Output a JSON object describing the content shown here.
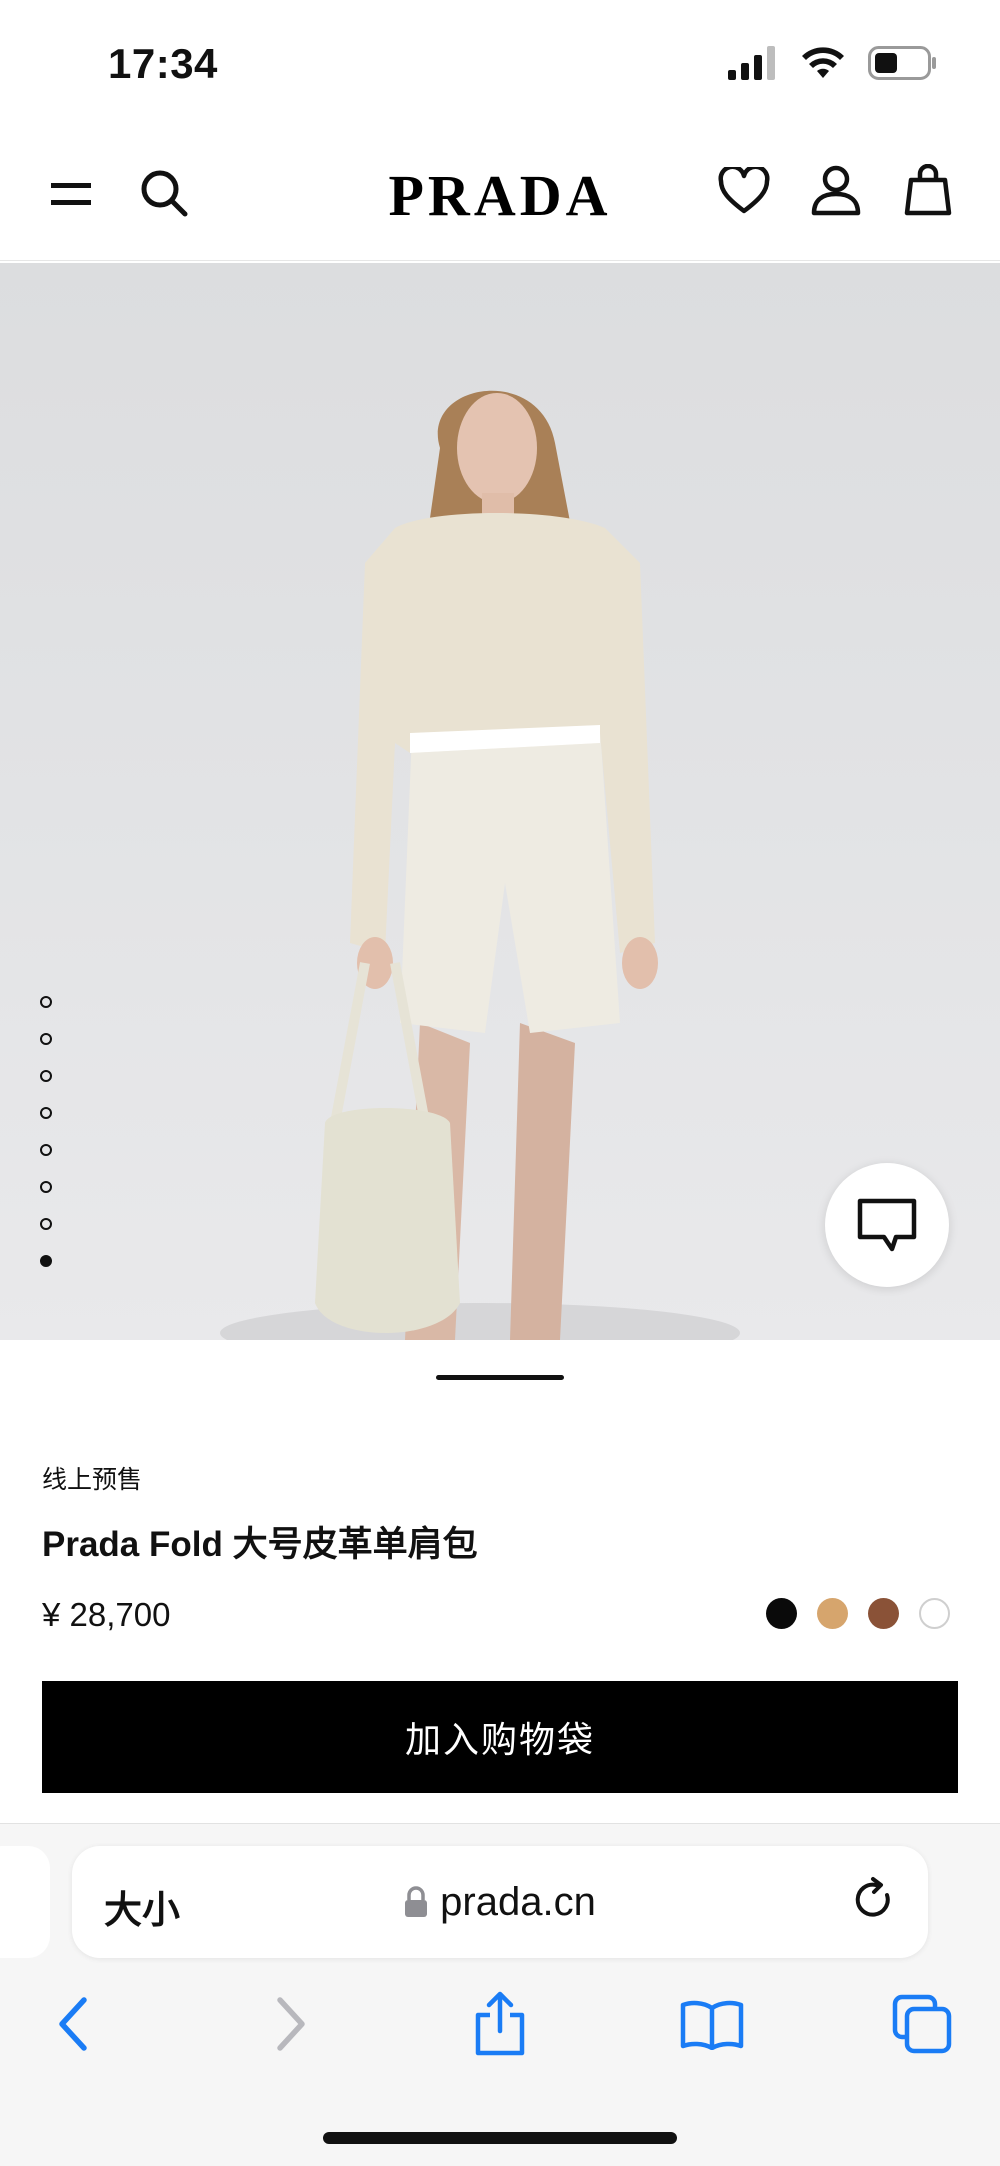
{
  "status_bar": {
    "time": "17:34"
  },
  "header": {
    "brand": "PRADA",
    "icons": [
      "menu-icon",
      "search-icon",
      "heart-icon",
      "account-icon",
      "bag-icon"
    ]
  },
  "gallery": {
    "slide_count": 8,
    "active_slide": 8
  },
  "product": {
    "presale_label": "线上预售",
    "title": "Prada Fold 大号皮革单肩包",
    "price": "¥ 28,700",
    "swatches": [
      "#0a0a0a",
      "#d6a56d",
      "#8a5237",
      "#ffffff"
    ],
    "add_to_bag_label": "加入购物袋"
  },
  "browser": {
    "text_size_label": "大小",
    "url": "prada.cn",
    "toolbar_icons": [
      "back-icon",
      "forward-icon",
      "share-icon",
      "bookmarks-icon",
      "tabs-icon"
    ]
  },
  "colors": {
    "accent": "#1a7cf5",
    "button": "#000000"
  }
}
